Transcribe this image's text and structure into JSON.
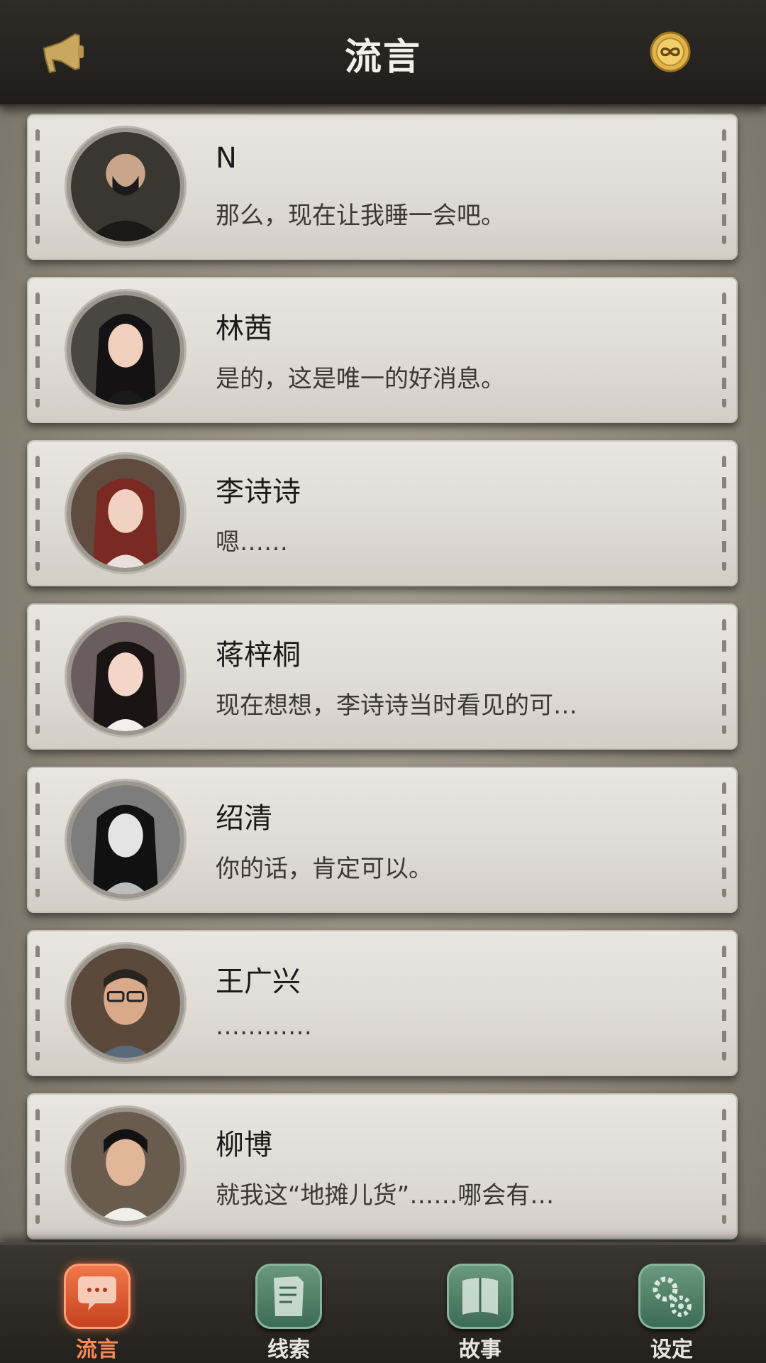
{
  "header": {
    "title": "流言",
    "left_icon": "megaphone-icon",
    "right_icon": "infinity-coin-icon"
  },
  "messages": [
    {
      "name": "N",
      "preview": "那么，现在让我睡一会吧。",
      "avatar": "avatar-n"
    },
    {
      "name": "林茜",
      "preview": "是的，这是唯一的好消息。",
      "avatar": "avatar-linqian"
    },
    {
      "name": "李诗诗",
      "preview": "嗯……",
      "avatar": "avatar-lishishi"
    },
    {
      "name": "蒋梓桐",
      "preview": "现在想想，李诗诗当时看见的可…",
      "avatar": "avatar-jiangzitong"
    },
    {
      "name": "绍清",
      "preview": "你的话，肯定可以。",
      "avatar": "avatar-shaoqing"
    },
    {
      "name": "王广兴",
      "preview": "…………",
      "avatar": "avatar-wangguangxing"
    },
    {
      "name": "柳博",
      "preview": "就我这“地摊儿货”……哪会有…",
      "avatar": "avatar-liubo"
    }
  ],
  "tabs": [
    {
      "label": "流言",
      "icon": "chat-bubble-icon",
      "active": true
    },
    {
      "label": "线索",
      "icon": "document-icon",
      "active": false
    },
    {
      "label": "故事",
      "icon": "book-icon",
      "active": false
    },
    {
      "label": "设定",
      "icon": "gears-icon",
      "active": false
    }
  ],
  "colors": {
    "header_bg": "#24211d",
    "card_bg": "#e3e0da",
    "active_tab": "#e35a2f",
    "inactive_tab": "#4d7f64"
  }
}
